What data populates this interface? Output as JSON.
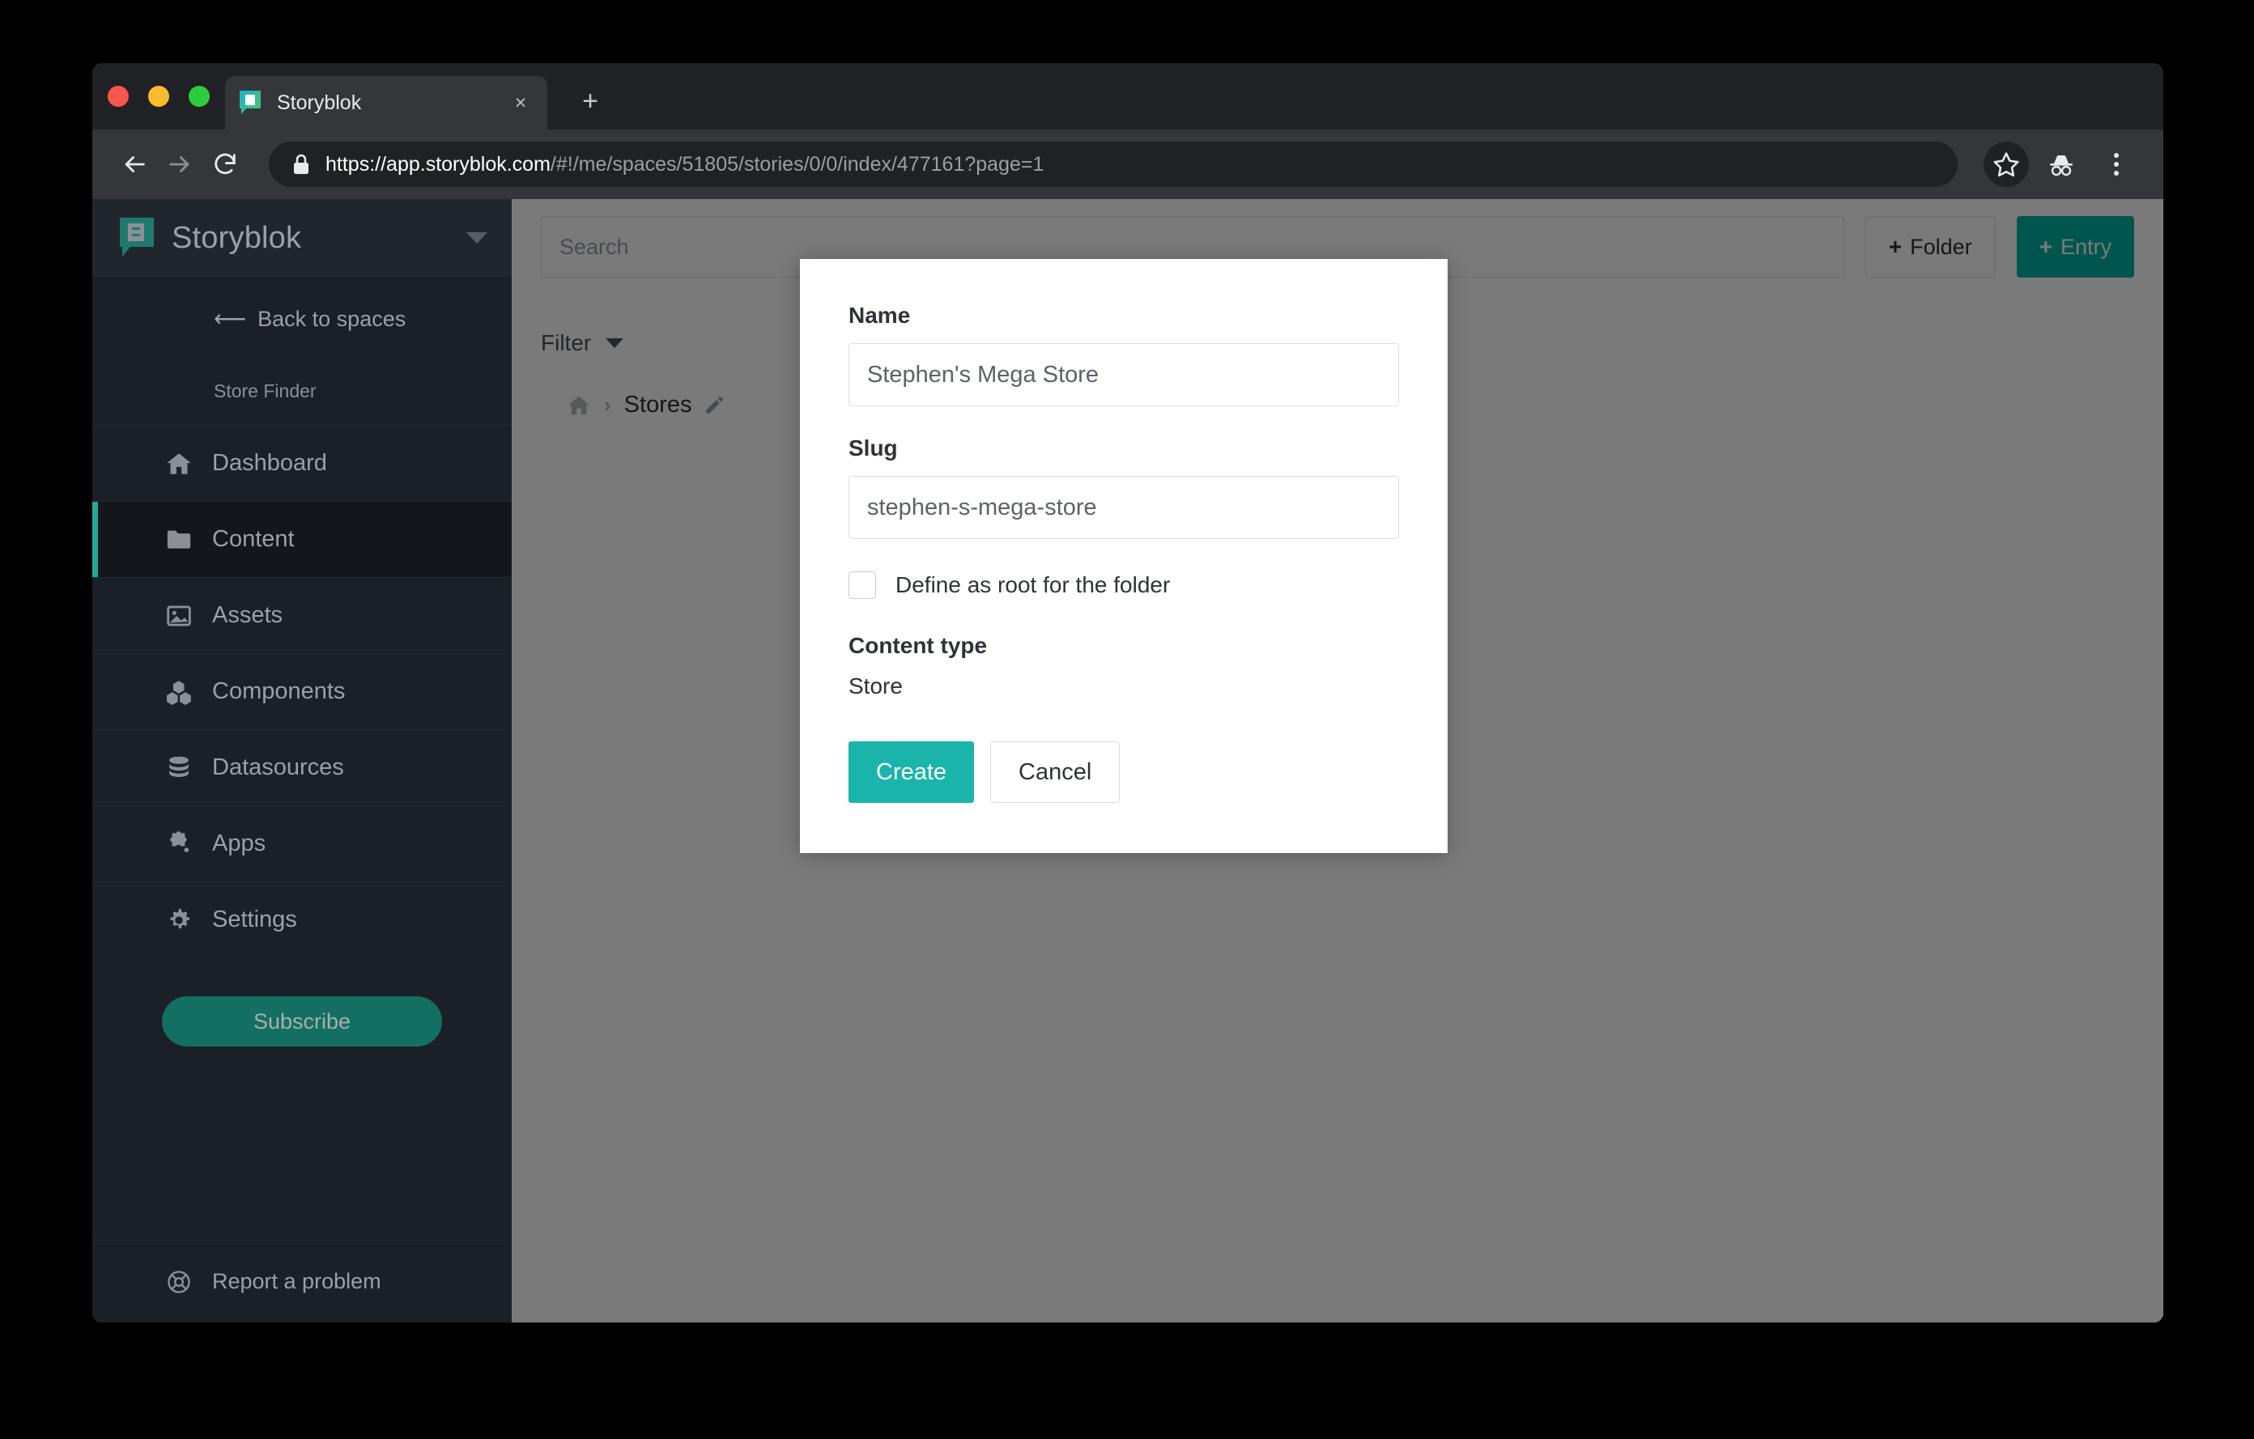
{
  "browser": {
    "tab": {
      "title": "Storyblok",
      "favicon_icon": "storyblok-favicon",
      "close_label": "×"
    },
    "new_tab_label": "+",
    "nav": {
      "back_icon": "arrow-left-icon",
      "forward_icon": "arrow-right-icon",
      "reload_icon": "reload-icon",
      "lock_icon": "padlock-icon"
    },
    "url": {
      "full": "https://app.storyblok.com/#!/me/spaces/51805/stories/0/0/index/477161?page=1",
      "host": "https://app.storyblok.com",
      "path": "/#!/me/spaces/51805/stories/0/0/index/477161?page=1"
    },
    "toolbar": {
      "bookmark_icon": "star-icon",
      "incognito_icon": "incognito-icon",
      "menu_icon": "three-dots-icon"
    },
    "traffic_lights": {
      "close": "#f9564f",
      "minimize": "#fcbb2d",
      "maximize": "#2dcc3f"
    }
  },
  "sidebar": {
    "brand": {
      "name": "Storyblok",
      "logo_icon": "storyblok-logo-icon",
      "switcher_icon": "chevron-down-icon"
    },
    "back_to_spaces": {
      "label": "Back to spaces",
      "icon": "long-arrow-left-icon"
    },
    "space_name": "Store Finder",
    "items": [
      {
        "label": "Dashboard",
        "icon": "home-icon",
        "active": false
      },
      {
        "label": "Content",
        "icon": "folder-icon",
        "active": true
      },
      {
        "label": "Assets",
        "icon": "image-icon",
        "active": false
      },
      {
        "label": "Components",
        "icon": "blocks-icon",
        "active": false
      },
      {
        "label": "Datasources",
        "icon": "database-icon",
        "active": false
      },
      {
        "label": "Apps",
        "icon": "puzzle-icon",
        "active": false
      },
      {
        "label": "Settings",
        "icon": "gear-icon",
        "active": false
      }
    ],
    "subscribe_label": "Subscribe",
    "report_problem": {
      "label": "Report a problem",
      "icon": "lifebuoy-icon"
    }
  },
  "content": {
    "search_placeholder": "Search",
    "search_value": "",
    "new_folder_label": "Folder",
    "new_entry_label": "Entry",
    "plus_glyph": "+",
    "filter_label": "Filter",
    "breadcrumb": {
      "home_icon": "home-icon",
      "separator": "›",
      "current": "Stores",
      "edit_icon": "pencil-icon"
    }
  },
  "modal": {
    "name_label": "Name",
    "name_value": "Stephen's Mega Store",
    "name_placeholder": "Name",
    "slug_label": "Slug",
    "slug_value": "stephen-s-mega-store",
    "slug_placeholder": "Slug",
    "root_checkbox_label": "Define as root for the folder",
    "root_checkbox_checked": false,
    "content_type_label": "Content type",
    "content_type_value": "Store",
    "create_label": "Create",
    "cancel_label": "Cancel"
  },
  "colors": {
    "brand_teal": "#00b3a4",
    "create_teal": "#1bb4ab",
    "subscribe_green": "#136f62",
    "active_bar": "#25a79b",
    "sidebar_bg": "#1b1f26",
    "overlay": "rgba(0,0,0,0.52)"
  }
}
